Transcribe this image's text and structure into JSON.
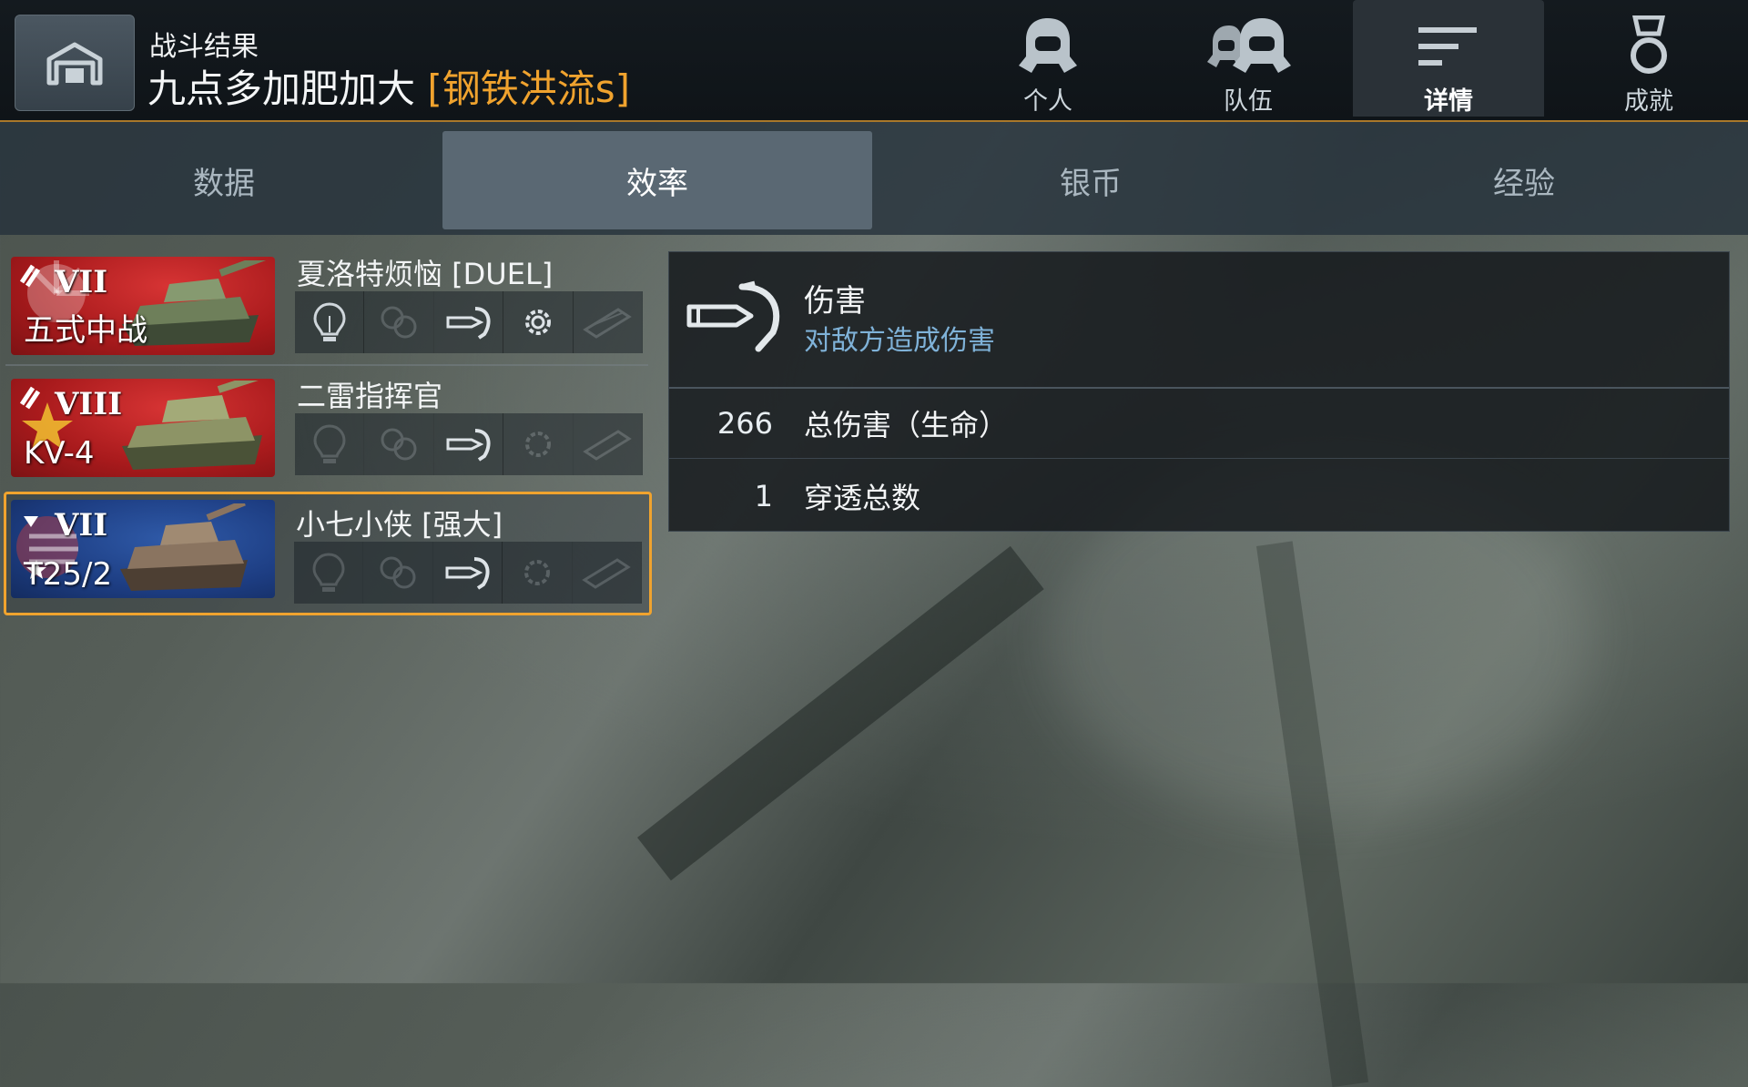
{
  "header": {
    "subtitle": "战斗结果",
    "player_name": "九点多加肥加大",
    "clan_tag": "[钢铁洪流s]"
  },
  "nav": [
    {
      "label": "个人",
      "icon": "single-helmet-icon",
      "active": false
    },
    {
      "label": "队伍",
      "icon": "team-helmets-icon",
      "active": false
    },
    {
      "label": "详情",
      "icon": "details-lines-icon",
      "active": true
    },
    {
      "label": "成就",
      "icon": "medal-icon",
      "active": false
    }
  ],
  "tabs": [
    {
      "label": "数据",
      "active": false
    },
    {
      "label": "效率",
      "active": true
    },
    {
      "label": "银币",
      "active": false
    },
    {
      "label": "经验",
      "active": false
    }
  ],
  "vehicles": [
    {
      "player": "夏洛特烦恼 [DUEL]",
      "tank": "五式中战",
      "tier": "VII",
      "nation_color": "red",
      "selected": false,
      "medals_active": [
        true,
        false,
        true,
        true,
        false
      ]
    },
    {
      "player": "二雷指挥官",
      "tank": "KV-4",
      "tier": "VIII",
      "nation_color": "red",
      "selected": false,
      "medals_active": [
        false,
        false,
        true,
        false,
        false
      ]
    },
    {
      "player": "小七小侠 [强大]",
      "tank": "T25/2",
      "tier": "VII",
      "nation_color": "blue",
      "selected": true,
      "medals_active": [
        false,
        false,
        true,
        false,
        false
      ]
    }
  ],
  "medal_icons": [
    "spotting-bulb-icon",
    "assist-arrows-icon",
    "damage-shell-icon",
    "module-gear-icon",
    "track-block-icon"
  ],
  "detail": {
    "icon": "damage-shell-icon",
    "title": "伤害",
    "subtitle": "对敌方造成伤害",
    "stats": [
      {
        "value": "266",
        "label": "总伤害（生命）"
      },
      {
        "value": "1",
        "label": "穿透总数"
      }
    ]
  },
  "colors": {
    "accent": "#f0a32e",
    "subtitle_blue": "#7fb2d8"
  }
}
